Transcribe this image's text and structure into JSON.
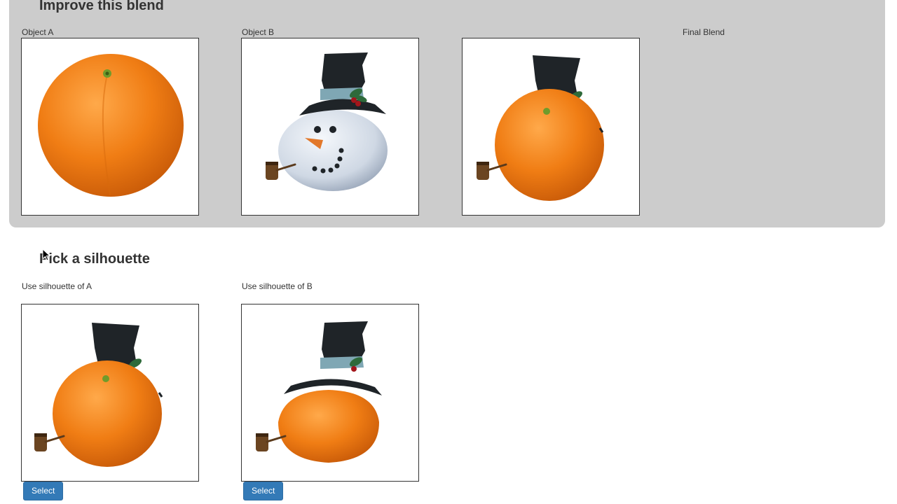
{
  "blend_panel": {
    "heading": "Improve this blend",
    "object_a_label": "Object A",
    "object_b_label": "Object B",
    "final_label": "Final Blend"
  },
  "silhouette_section": {
    "heading": "Pick a silhouette",
    "option_a_label": "Use silhouette of A",
    "option_b_label": "Use silhouette of B",
    "select_label": "Select"
  },
  "colors": {
    "panel_bg": "#cccccc",
    "button_bg": "#337ab7",
    "orange": "#f07d14",
    "hat": "#1f2428",
    "scarf": "#7fa7b4"
  }
}
